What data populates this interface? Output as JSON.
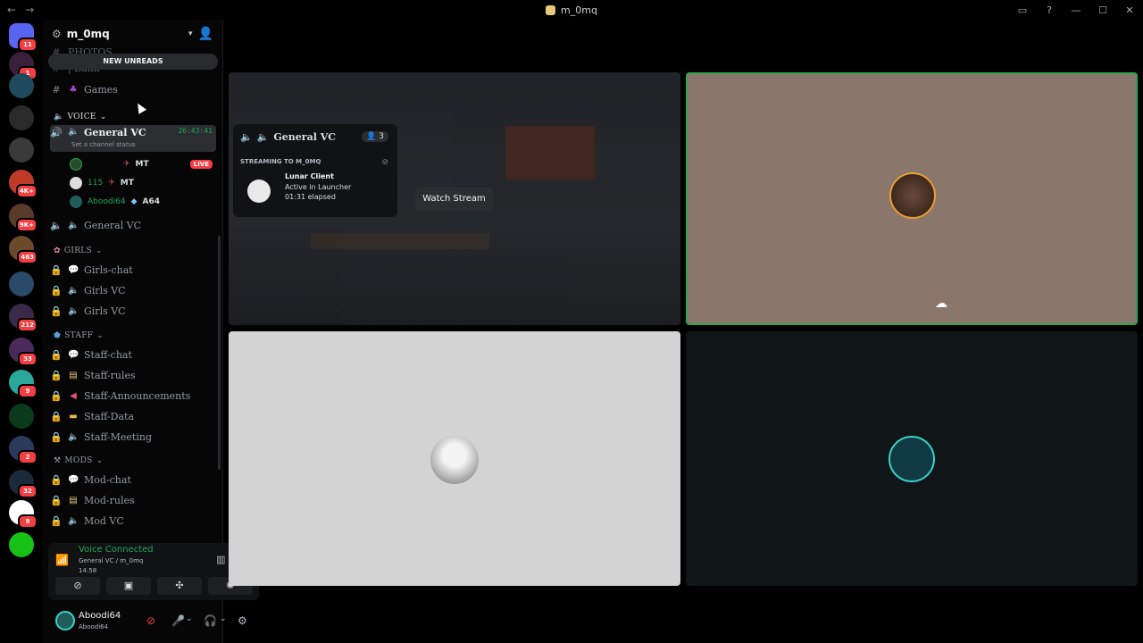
{
  "window": {
    "title": "m_0mq"
  },
  "servers": [
    {
      "name": "discord-home",
      "badge": "11",
      "color": "#5865f2"
    },
    {
      "name": "server-2",
      "badge": "1",
      "color": "#3a1f3a"
    },
    {
      "name": "server-3",
      "badge": "",
      "color": "#1f4b5c"
    },
    {
      "name": "server-4",
      "badge": "",
      "color": "#2a2a2a"
    },
    {
      "name": "server-5",
      "badge": "",
      "color": "#3a3a3a"
    },
    {
      "name": "server-6",
      "badge": "4K+",
      "color": "#c03a2a"
    },
    {
      "name": "server-7",
      "badge": "9K+",
      "color": "#5a3a2a"
    },
    {
      "name": "server-8",
      "badge": "463",
      "color": "#6a4a2a"
    },
    {
      "name": "server-9",
      "badge": "",
      "color": "#2a4a6a"
    },
    {
      "name": "server-10",
      "badge": "212",
      "color": "#3a2a4a"
    },
    {
      "name": "server-11",
      "badge": "33",
      "color": "#4a2a5a"
    },
    {
      "name": "server-12",
      "badge": "9",
      "color": "#2aa89a"
    },
    {
      "name": "server-13",
      "badge": "",
      "color": "#0a3a1a"
    },
    {
      "name": "server-14",
      "badge": "2",
      "color": "#2a3a5a"
    },
    {
      "name": "server-15",
      "badge": "32",
      "color": "#1a2a3a"
    },
    {
      "name": "server-16",
      "badge": "9",
      "color": "#ffffff"
    },
    {
      "name": "server-17",
      "badge": "",
      "color": "#17c217"
    }
  ],
  "sidebar": {
    "server_name": "m_0mq",
    "new_unreads": "NEW UNREADS",
    "partial_top": "PHOTOS",
    "partial_bank": "| Bank",
    "games": "Games",
    "voice_cat": "VOICE",
    "general_vc": "General VC",
    "general_vc_timer": "26:43:41",
    "set_status": "Set a channel status",
    "members": [
      {
        "name": "",
        "tag": "MT",
        "live": "LIVE"
      },
      {
        "name": "115",
        "tag": "MT"
      },
      {
        "name": "Aboodi64",
        "tag": "A64"
      }
    ],
    "general_vc_2": "General VC",
    "girls_cat": "GIRLS",
    "girls_chat": "Girls-chat",
    "girls_vc_1": "Girls VC",
    "girls_vc_2": "Girls VC",
    "staff_cat": "STAFF",
    "staff_chat": "Staff-chat",
    "staff_rules": "Staff-rules",
    "staff_ann": "Staff-Announcements",
    "staff_data": "Staff-Data",
    "staff_meeting": "Staff-Meeting",
    "mods_cat": "MODS",
    "mod_chat": "Mod-chat",
    "mod_rules": "Mod-rules",
    "mod_vc": "Mod VC"
  },
  "voice": {
    "connected": "Voice Connected",
    "channel": "General VC / m_0mq",
    "time": "14:58"
  },
  "user": {
    "name": "Aboodi64",
    "tag": "Aboodi64"
  },
  "stage": {
    "popup_channel": "General VC",
    "popup_count": "3",
    "streaming_to": "STREAMING TO M_0MQ",
    "app_name": "Lunar Client",
    "app_status": "Active in Launcher",
    "elapsed": "01:31 elapsed",
    "watch_stream": "Watch Stream"
  }
}
